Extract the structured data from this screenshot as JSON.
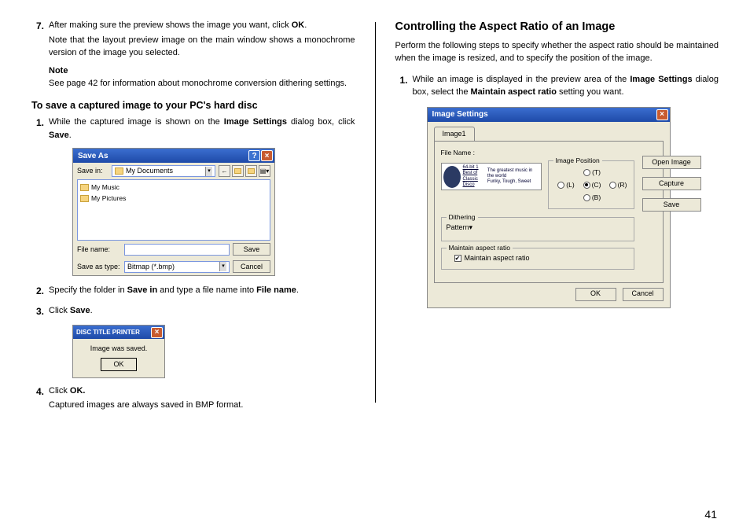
{
  "left": {
    "step7": {
      "num": "7.",
      "text": "After making sure the preview shows the image you want, click ",
      "bold": "OK",
      "tail": ".",
      "sub": "Note that the layout preview image on the main window shows a monochrome version of the image you selected."
    },
    "note_h": "Note",
    "note_t": "See page 42 for information about monochrome conversion dithering settings.",
    "save_h": "To save a captured image to your PC's hard disc",
    "step1": {
      "num": "1.",
      "a": "While the captured image is shown on the ",
      "b": "Image Settings",
      "c": " dialog box, click ",
      "d": "Save",
      "e": "."
    },
    "step2": {
      "num": "2.",
      "a": "Specify the folder in ",
      "b": "Save in",
      "c": " and type a file name into ",
      "d": "File name",
      "e": "."
    },
    "step3": {
      "num": "3.",
      "a": "Click ",
      "b": "Save",
      "c": "."
    },
    "step4": {
      "num": "4.",
      "a": "Click ",
      "b": "OK.",
      "sub": "Captured images are always saved in BMP format."
    }
  },
  "saveas": {
    "title": "Save As",
    "savein_lbl": "Save in:",
    "savein_val": "My Documents",
    "items": [
      "My Music",
      "My Pictures"
    ],
    "filename_lbl": "File name:",
    "filename_val": "",
    "type_lbl": "Save as type:",
    "type_val": "Bitmap (*.bmp)",
    "save_btn": "Save",
    "cancel_btn": "Cancel"
  },
  "msg": {
    "title": "DISC TITLE PRINTER",
    "text": "Image was saved.",
    "ok": "OK"
  },
  "right": {
    "h": "Controlling the Aspect Ratio of an Image",
    "intro": "Perform the following steps to specify whether the aspect ratio should be maintained when the image is resized, and to specify the position of the image.",
    "step1": {
      "num": "1.",
      "a": "While an image is displayed in the preview area of the ",
      "b": "Image Settings",
      "c": " dialog box, select the ",
      "d": "Maintain aspect ratio",
      "e": " setting you want."
    }
  },
  "imgdlg": {
    "title": "Image Settings",
    "tab": "Image1",
    "filename_lbl": "File Name :",
    "pos_title": "Image Position",
    "pos": {
      "t": "(T)",
      "l": "(L)",
      "c": "(C)",
      "r": "(R)",
      "b": "(B)"
    },
    "dith_title": "Dithering",
    "dith_val": "Pattern",
    "mar_title": "Maintain aspect ratio",
    "mar_chk": "Maintain aspect ratio",
    "btn_open": "Open Image",
    "btn_cap": "Capture",
    "btn_save": "Save",
    "ok": "OK",
    "cancel": "Cancel",
    "pv1": "64-bit 1",
    "pv2": "Best of",
    "pv3": "Classic Disco",
    "pv4": "The greatest music in the world",
    "pv5": "Funky, Tough, Sweet"
  },
  "page": "41"
}
